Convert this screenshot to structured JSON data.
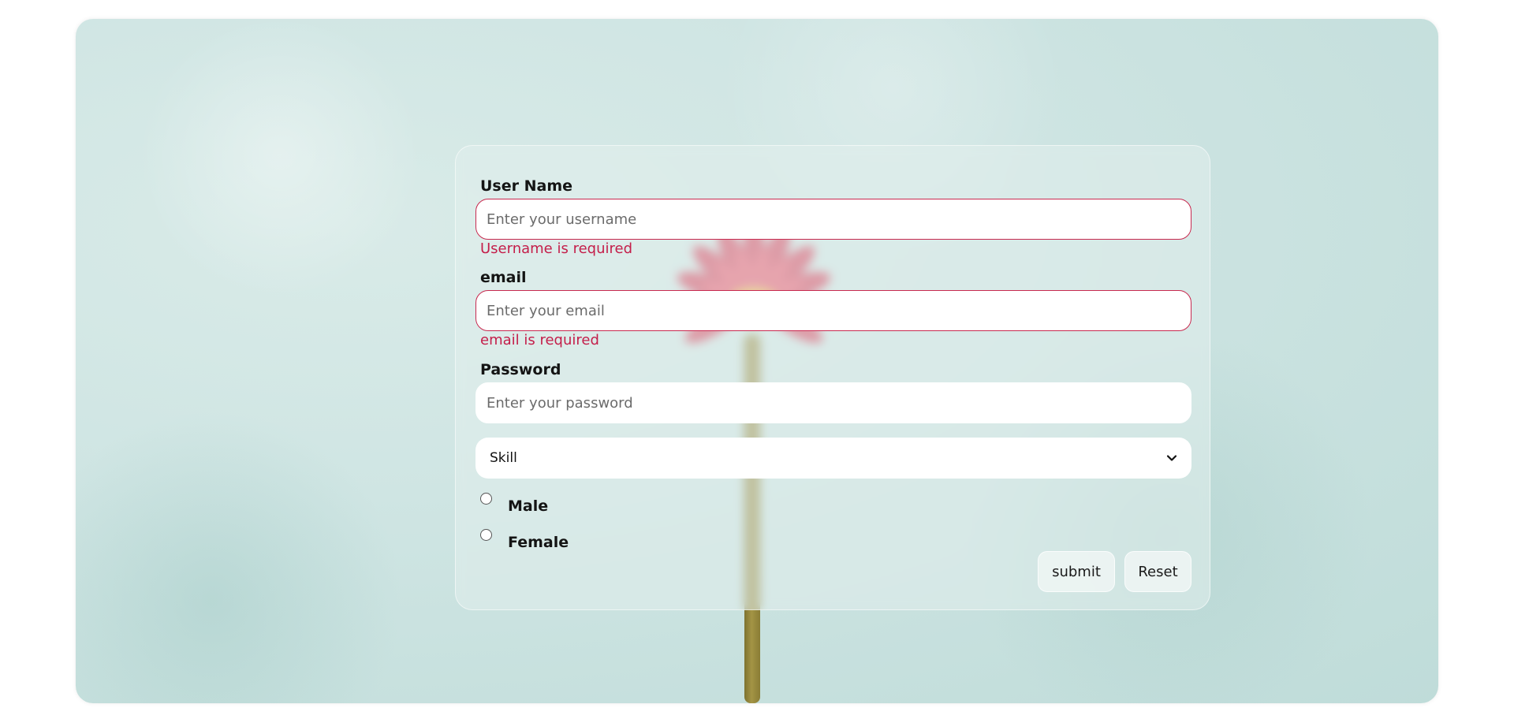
{
  "form": {
    "username": {
      "label": "User Name",
      "placeholder": "Enter your username",
      "value": "",
      "error": "Username is required"
    },
    "email": {
      "label": "email",
      "placeholder": "Enter your email",
      "value": "",
      "error": "email is required"
    },
    "password": {
      "label": "Password",
      "placeholder": "Enter your password",
      "value": ""
    },
    "skill": {
      "selected": "Skill",
      "icon": "chevron-down-icon"
    },
    "gender": {
      "options": [
        "Male",
        "Female"
      ]
    },
    "buttons": {
      "submit": "submit",
      "reset": "Reset"
    }
  },
  "colors": {
    "error": "#c41e4a",
    "invalid_border": "#c8294f",
    "background": "#cfe5e3",
    "petal": "#e0354f",
    "flower_center": "#f2c230",
    "stem": "#a39445"
  }
}
